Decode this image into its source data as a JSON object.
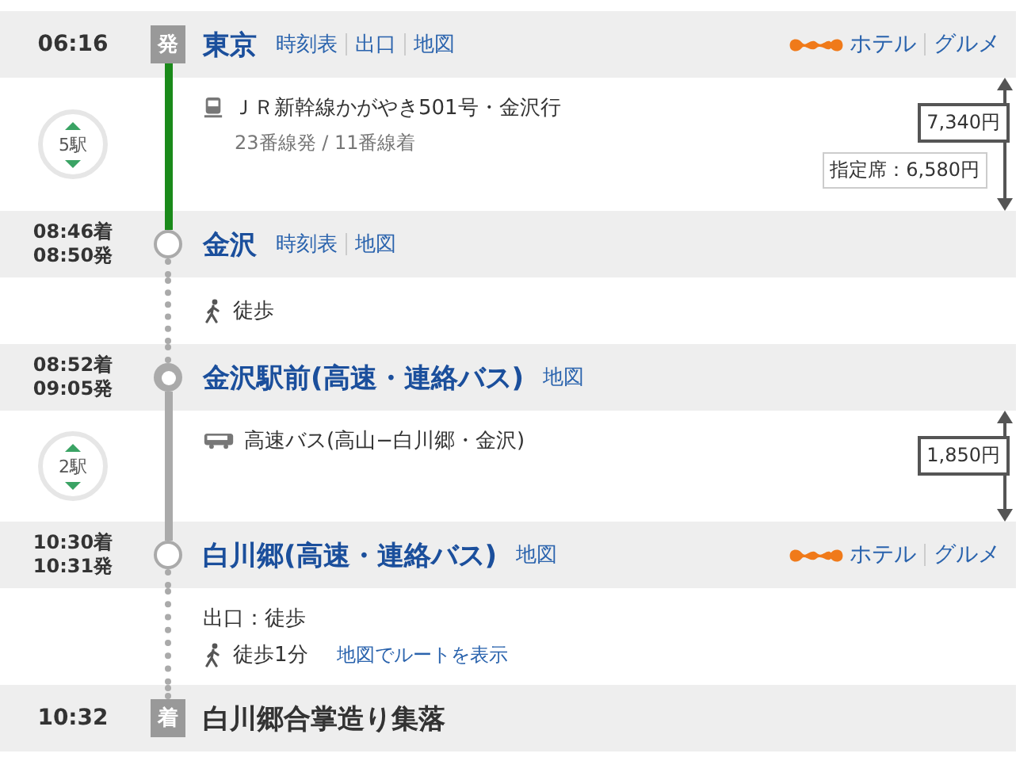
{
  "route": [
    {
      "kind": "station",
      "marker": {
        "kind": "depart",
        "label": "発"
      },
      "times": [
        "06:16"
      ],
      "name": "東京",
      "links": [
        "時刻表",
        "出口",
        "地図"
      ],
      "services": [
        "ホテル",
        "グルメ"
      ]
    },
    {
      "kind": "segment",
      "line": {
        "kind": "rail"
      },
      "stops": "5駅",
      "service": "ＪＲ新幹線かがやき501号・金沢行",
      "platforms": "23番線発 / 11番線着",
      "fare": "7,340円",
      "reserved_fare": "指定席：6,580円"
    },
    {
      "kind": "station",
      "marker": {
        "kind": "stop"
      },
      "times": [
        "08:46着",
        "08:50発"
      ],
      "name": "金沢",
      "links": [
        "時刻表",
        "地図"
      ]
    },
    {
      "kind": "segment",
      "line": {
        "kind": "walk"
      },
      "walk": "徒歩"
    },
    {
      "kind": "station",
      "marker": {
        "kind": "bus_stop"
      },
      "times": [
        "08:52着",
        "09:05発"
      ],
      "name": "金沢駅前(高速・連絡バス)",
      "links": [
        "地図"
      ]
    },
    {
      "kind": "segment",
      "line": {
        "kind": "bus"
      },
      "stops": "2駅",
      "service": "高速バス(高山−白川郷・金沢)",
      "fare": "1,850円"
    },
    {
      "kind": "station",
      "marker": {
        "kind": "stop"
      },
      "times": [
        "10:30着",
        "10:31発"
      ],
      "name": "白川郷(高速・連絡バス)",
      "links": [
        "地図"
      ],
      "services": [
        "ホテル",
        "グルメ"
      ]
    },
    {
      "kind": "segment",
      "line": {
        "kind": "walk"
      },
      "exit": "出口：徒歩",
      "walk": "徒歩1分",
      "route_link": "地図でルートを表示"
    },
    {
      "kind": "station",
      "marker": {
        "kind": "arrive",
        "label": "着"
      },
      "times": [
        "10:32"
      ],
      "name": "白川郷合掌造り集落"
    }
  ]
}
